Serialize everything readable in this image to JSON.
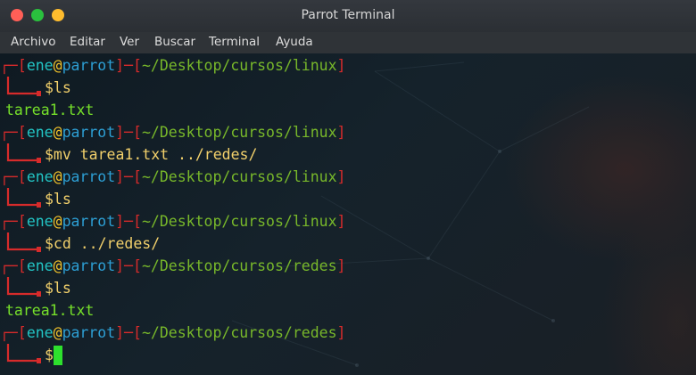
{
  "window": {
    "title": "Parrot Terminal",
    "buttons": [
      "close",
      "maximize",
      "minimize"
    ]
  },
  "menu": [
    "Archivo",
    "Editar",
    "Ver",
    "Buscar",
    "Terminal",
    "Ayuda"
  ],
  "prompt": {
    "user": "ene",
    "at": "@",
    "host": "parrot"
  },
  "lines": [
    {
      "type": "header",
      "path": "~/Desktop/cursos/linux"
    },
    {
      "type": "cmd",
      "text": "$ls"
    },
    {
      "type": "output",
      "text": "tarea1.txt"
    },
    {
      "type": "header",
      "path": "~/Desktop/cursos/linux"
    },
    {
      "type": "cmd",
      "text": "$mv tarea1.txt ../redes/"
    },
    {
      "type": "header",
      "path": "~/Desktop/cursos/linux"
    },
    {
      "type": "cmd",
      "text": "$ls"
    },
    {
      "type": "header",
      "path": "~/Desktop/cursos/linux"
    },
    {
      "type": "cmd",
      "text": "$cd ../redes/"
    },
    {
      "type": "header",
      "path": "~/Desktop/cursos/redes"
    },
    {
      "type": "cmd",
      "text": "$ls"
    },
    {
      "type": "output",
      "text": "tarea1.txt"
    },
    {
      "type": "header",
      "path": "~/Desktop/cursos/redes"
    },
    {
      "type": "cmd",
      "text": "$"
    }
  ],
  "colors": {
    "bracket": "#d72b2b",
    "user": "#22c4c4",
    "at": "#f2c32a",
    "host": "#2d9fd4",
    "path": "#78b82a",
    "command": "#f2d06b",
    "output": "#76e02a",
    "cursor": "#2de02d"
  }
}
